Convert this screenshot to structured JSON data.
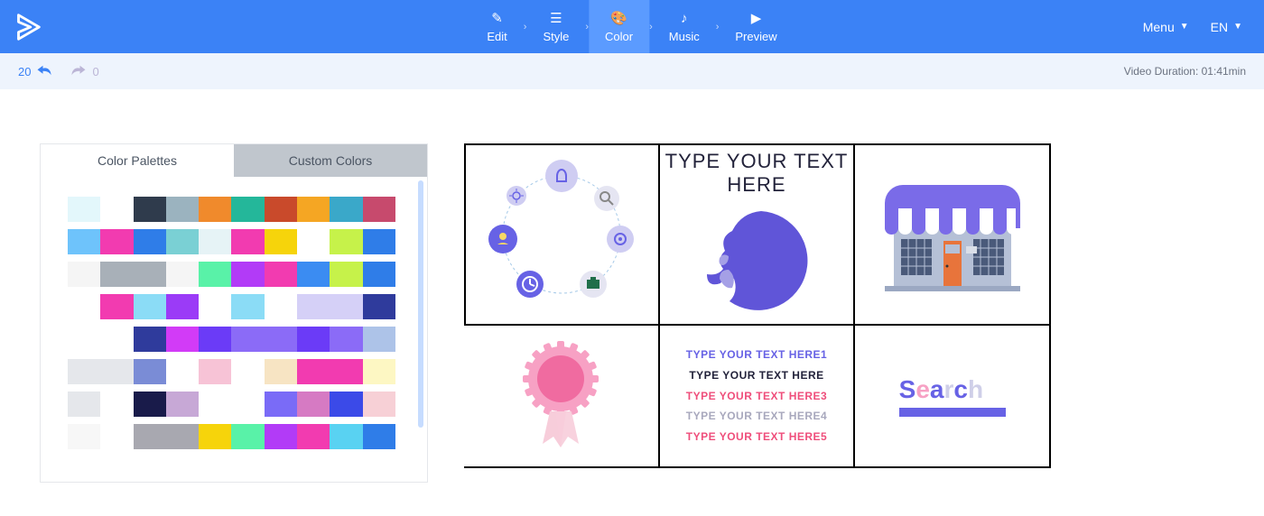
{
  "header": {
    "steps": [
      {
        "label": "Edit",
        "icon": "✎"
      },
      {
        "label": "Style",
        "icon": "☰"
      },
      {
        "label": "Color",
        "icon": "🎨",
        "active": true
      },
      {
        "label": "Music",
        "icon": "♪"
      },
      {
        "label": "Preview",
        "icon": "▶"
      }
    ],
    "menu_label": "Menu",
    "lang_label": "EN"
  },
  "subheader": {
    "undo_count": "20",
    "redo_count": "0",
    "duration_label": "Video Duration: 01:41min"
  },
  "panel": {
    "tab_palettes": "Color Palettes",
    "tab_custom": "Custom Colors",
    "palettes": [
      [
        "#e3f7fb",
        "#ffffff",
        "#2f3b4c",
        "#9bb3bf",
        "#f08a2c",
        "#24b79a",
        "#c94a2b",
        "#f5a623",
        "#3aa8c9",
        "#c74a6d"
      ],
      [
        "#6ec3fb",
        "#f23bb0",
        "#2f7de8",
        "#7ad0d4",
        "#e6f3f6",
        "#f23bb0",
        "#f6d40b",
        "#ffffff",
        "#c6f24a",
        "#2f7de8"
      ],
      [
        "#f5f5f5",
        "#a8b0b8",
        "#a8b0b8",
        "#f5f5f5",
        "#59f2a8",
        "#b23bf7",
        "#f23bb0",
        "#3b8cf2",
        "#c6f24a",
        "#2f7de8"
      ],
      [
        "#ffffff",
        "#f23bb0",
        "#8bdcf6",
        "#9b3bf7",
        "#ffffff",
        "#8bdcf6",
        "#ffffff",
        "#d5d0f7",
        "#d5d0f7",
        "#2f3b9c"
      ],
      [
        "#ffffff",
        "#ffffff",
        "#2f3b9c",
        "#d23bf7",
        "#6b3bf7",
        "#8b6bf7",
        "#8b6bf7",
        "#6b3bf7",
        "#8b6bf7",
        "#adc3e8"
      ],
      [
        "#e5e7eb",
        "#e5e7eb",
        "#7a8cd6",
        "#ffffff",
        "#f7c3d6",
        "#ffffff",
        "#f7e4c3",
        "#f23bb0",
        "#f23bb0",
        "#fdf7c3"
      ],
      [
        "#e5e7eb",
        "#ffffff",
        "#191b4a",
        "#c7a8d6",
        "#ffffff",
        "#ffffff",
        "#7a6bf7",
        "#d67ac3",
        "#3b4ae8",
        "#f7d0d6"
      ],
      [
        "#f7f7f7",
        "#ffffff",
        "#a8a8b0",
        "#a8a8b0",
        "#f6d40b",
        "#59f2a8",
        "#b23bf7",
        "#f23bb0",
        "#59d2f2",
        "#2f7de8"
      ]
    ]
  },
  "preview": {
    "headline": "TYPE YOUR  TEXT HERE",
    "lines": [
      "TYPE YOUR TEXT HERE1",
      "TYPE YOUR TEXT HERE",
      "TYPE YOUR TEXT HERE3",
      "TYPE YOUR TEXT HERE4",
      "TYPE YOUR TEXT HERE5"
    ],
    "search": "Search"
  }
}
